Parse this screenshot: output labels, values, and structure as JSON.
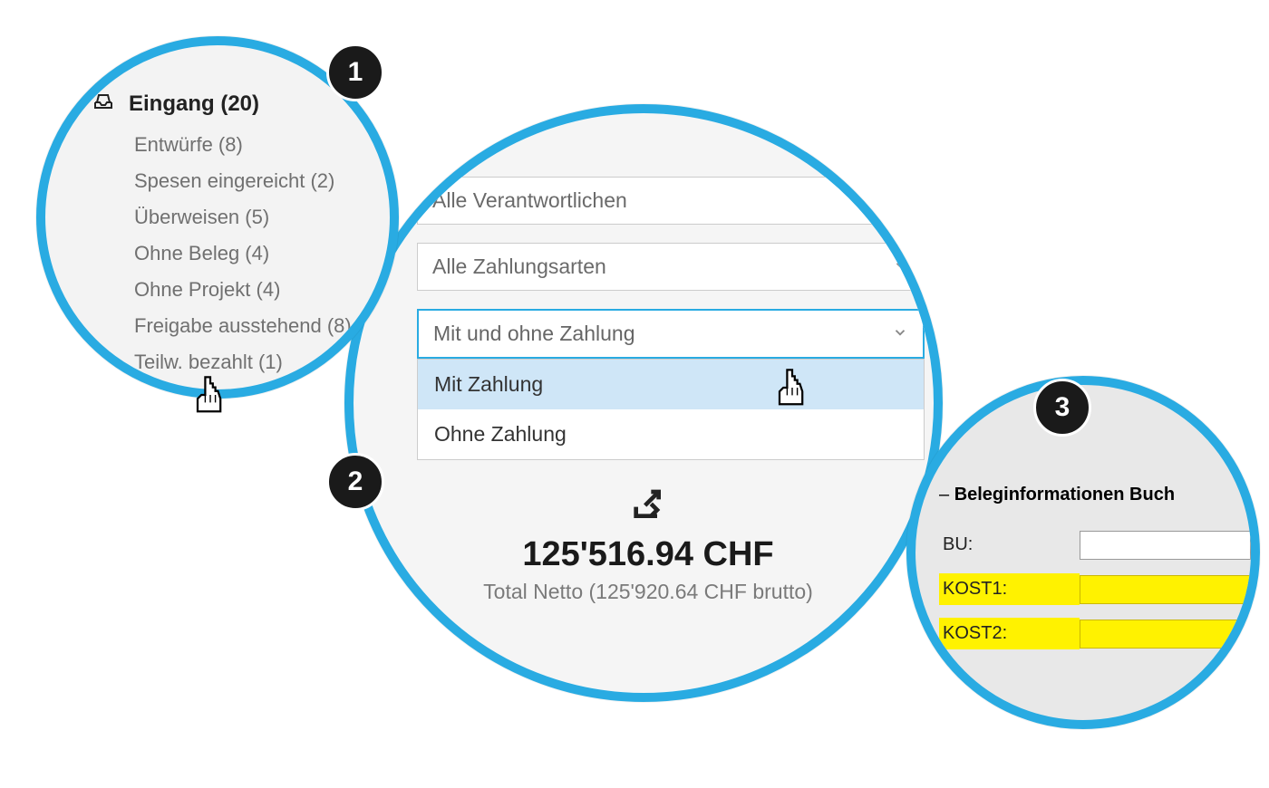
{
  "badges": {
    "b1": "1",
    "b2": "2",
    "b3": "3"
  },
  "sidebar": {
    "title": "Eingang (20)",
    "items": [
      "Entwürfe (8)",
      "Spesen eingereicht (2)",
      "Überweisen (5)",
      "Ohne Beleg (4)",
      "Ohne Projekt (4)",
      "Freigabe ausstehend (8)",
      "Teilw. bezahlt (1)"
    ]
  },
  "filters": {
    "responsible": "Alle Verantwortlichen",
    "paymentTypes": "Alle Zahlungsarten",
    "paymentStatus": "Mit und ohne Zahlung",
    "options": {
      "withPayment": "Mit Zahlung",
      "withoutPayment": "Ohne Zahlung"
    }
  },
  "totals": {
    "main": "125'516.94 CHF",
    "sub": "Total Netto (125'920.64 CHF brutto)"
  },
  "panel": {
    "title": "Beleginformationen Buch",
    "rows": {
      "bu": "BU:",
      "kost1": "KOST1:",
      "kost2": "KOST2:"
    }
  }
}
